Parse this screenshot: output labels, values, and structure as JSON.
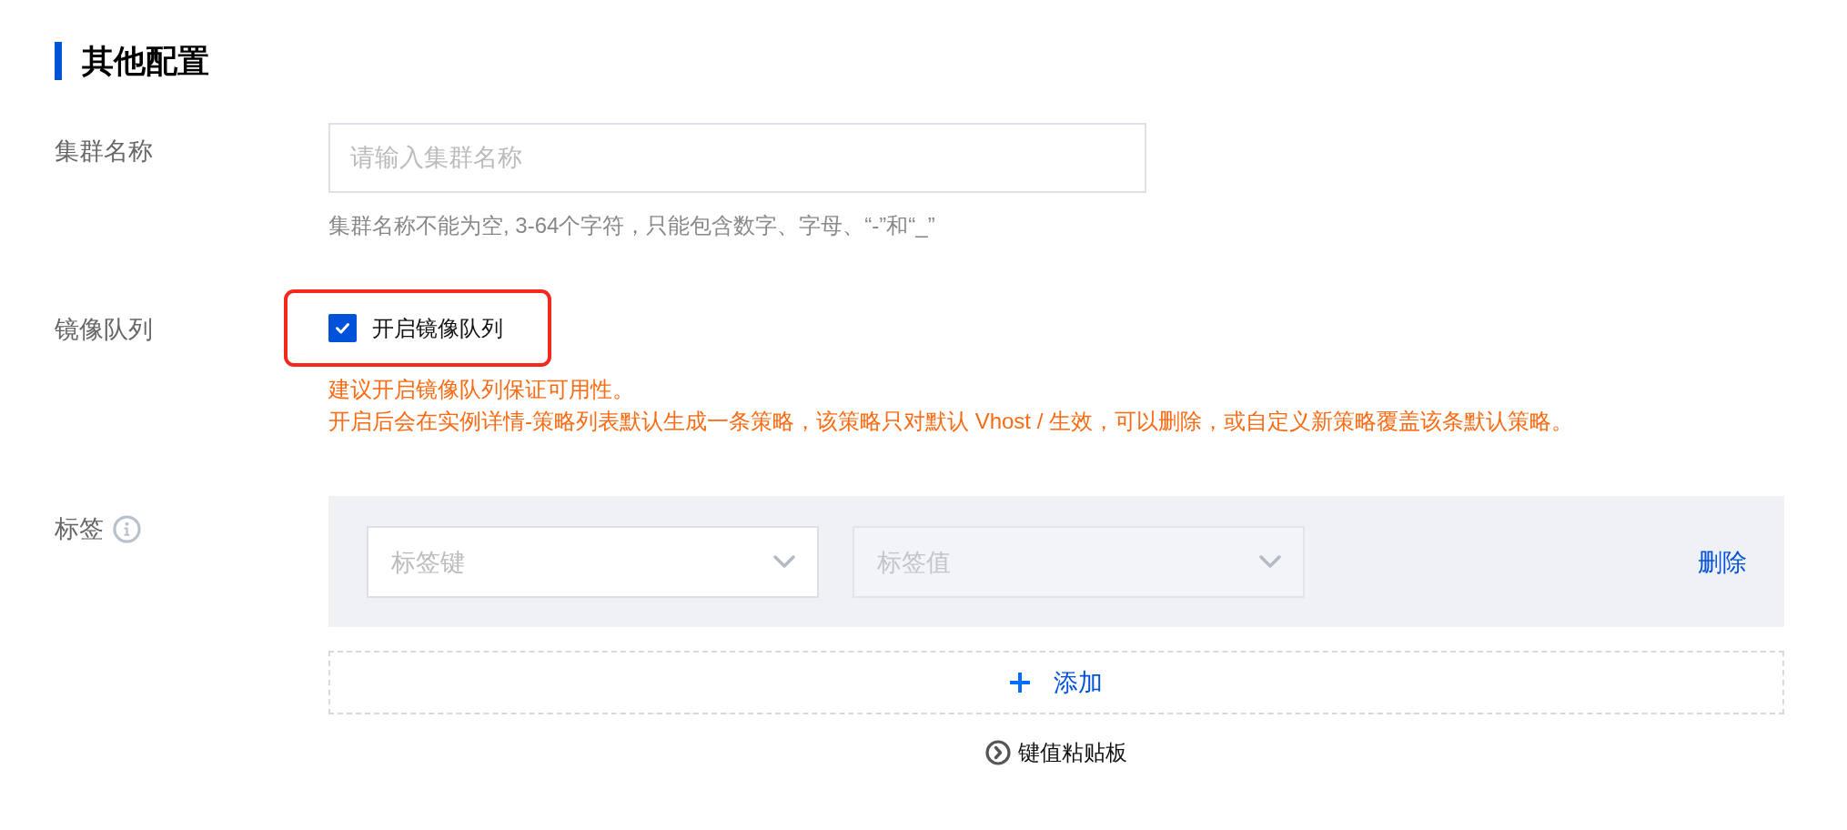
{
  "section": {
    "title": "其他配置"
  },
  "fields": [
    {
      "kind": "text",
      "label": "集群名称",
      "input": {
        "placeholder": "请输入集群名称"
      },
      "help": "集群名称不能为空, 3-64个字符，只能包含数字、字母、“-”和“_”"
    },
    {
      "kind": "checkbox",
      "label": "镜像队列",
      "checkbox": {
        "label": "开启镜像队列",
        "checked": true,
        "highlighted": true
      },
      "notes": [
        "建议开启镜像队列保证可用性。",
        "开启后会在实例详情-策略列表默认生成一条策略，该策略只对默认 Vhost / 生效，可以删除，或自定义新策略覆盖该条默认策略。"
      ]
    },
    {
      "kind": "tags",
      "label": "标签",
      "info": true,
      "rows": [
        {
          "key": {
            "placeholder": "标签键",
            "disabled": false
          },
          "value": {
            "placeholder": "标签值",
            "disabled": true
          },
          "delete_label": "删除"
        }
      ],
      "add_label": "添加",
      "paste_label": "键值粘贴板"
    }
  ]
}
